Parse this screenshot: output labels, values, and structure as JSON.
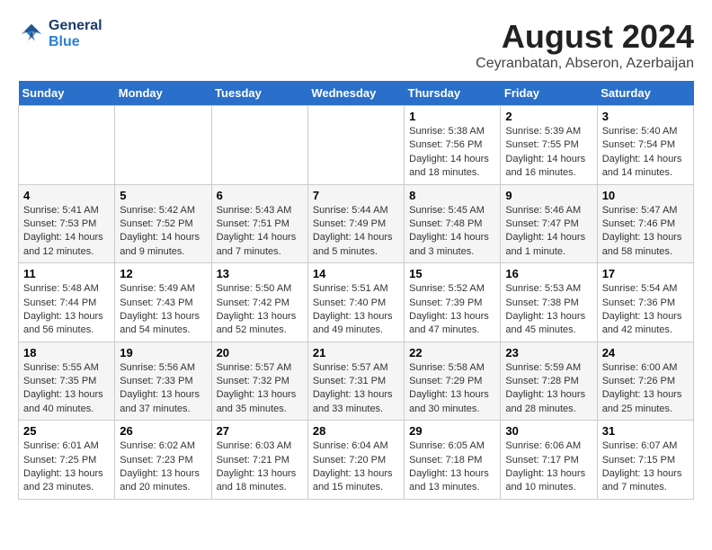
{
  "header": {
    "logo_line1": "General",
    "logo_line2": "Blue",
    "title": "August 2024",
    "subtitle": "Ceyranbatan, Abseron, Azerbaijan"
  },
  "weekdays": [
    "Sunday",
    "Monday",
    "Tuesday",
    "Wednesday",
    "Thursday",
    "Friday",
    "Saturday"
  ],
  "weeks": [
    [
      {
        "day": "",
        "info": ""
      },
      {
        "day": "",
        "info": ""
      },
      {
        "day": "",
        "info": ""
      },
      {
        "day": "",
        "info": ""
      },
      {
        "day": "1",
        "sunrise": "Sunrise: 5:38 AM",
        "sunset": "Sunset: 7:56 PM",
        "daylight": "Daylight: 14 hours and 18 minutes."
      },
      {
        "day": "2",
        "sunrise": "Sunrise: 5:39 AM",
        "sunset": "Sunset: 7:55 PM",
        "daylight": "Daylight: 14 hours and 16 minutes."
      },
      {
        "day": "3",
        "sunrise": "Sunrise: 5:40 AM",
        "sunset": "Sunset: 7:54 PM",
        "daylight": "Daylight: 14 hours and 14 minutes."
      }
    ],
    [
      {
        "day": "4",
        "sunrise": "Sunrise: 5:41 AM",
        "sunset": "Sunset: 7:53 PM",
        "daylight": "Daylight: 14 hours and 12 minutes."
      },
      {
        "day": "5",
        "sunrise": "Sunrise: 5:42 AM",
        "sunset": "Sunset: 7:52 PM",
        "daylight": "Daylight: 14 hours and 9 minutes."
      },
      {
        "day": "6",
        "sunrise": "Sunrise: 5:43 AM",
        "sunset": "Sunset: 7:51 PM",
        "daylight": "Daylight: 14 hours and 7 minutes."
      },
      {
        "day": "7",
        "sunrise": "Sunrise: 5:44 AM",
        "sunset": "Sunset: 7:49 PM",
        "daylight": "Daylight: 14 hours and 5 minutes."
      },
      {
        "day": "8",
        "sunrise": "Sunrise: 5:45 AM",
        "sunset": "Sunset: 7:48 PM",
        "daylight": "Daylight: 14 hours and 3 minutes."
      },
      {
        "day": "9",
        "sunrise": "Sunrise: 5:46 AM",
        "sunset": "Sunset: 7:47 PM",
        "daylight": "Daylight: 14 hours and 1 minute."
      },
      {
        "day": "10",
        "sunrise": "Sunrise: 5:47 AM",
        "sunset": "Sunset: 7:46 PM",
        "daylight": "Daylight: 13 hours and 58 minutes."
      }
    ],
    [
      {
        "day": "11",
        "sunrise": "Sunrise: 5:48 AM",
        "sunset": "Sunset: 7:44 PM",
        "daylight": "Daylight: 13 hours and 56 minutes."
      },
      {
        "day": "12",
        "sunrise": "Sunrise: 5:49 AM",
        "sunset": "Sunset: 7:43 PM",
        "daylight": "Daylight: 13 hours and 54 minutes."
      },
      {
        "day": "13",
        "sunrise": "Sunrise: 5:50 AM",
        "sunset": "Sunset: 7:42 PM",
        "daylight": "Daylight: 13 hours and 52 minutes."
      },
      {
        "day": "14",
        "sunrise": "Sunrise: 5:51 AM",
        "sunset": "Sunset: 7:40 PM",
        "daylight": "Daylight: 13 hours and 49 minutes."
      },
      {
        "day": "15",
        "sunrise": "Sunrise: 5:52 AM",
        "sunset": "Sunset: 7:39 PM",
        "daylight": "Daylight: 13 hours and 47 minutes."
      },
      {
        "day": "16",
        "sunrise": "Sunrise: 5:53 AM",
        "sunset": "Sunset: 7:38 PM",
        "daylight": "Daylight: 13 hours and 45 minutes."
      },
      {
        "day": "17",
        "sunrise": "Sunrise: 5:54 AM",
        "sunset": "Sunset: 7:36 PM",
        "daylight": "Daylight: 13 hours and 42 minutes."
      }
    ],
    [
      {
        "day": "18",
        "sunrise": "Sunrise: 5:55 AM",
        "sunset": "Sunset: 7:35 PM",
        "daylight": "Daylight: 13 hours and 40 minutes."
      },
      {
        "day": "19",
        "sunrise": "Sunrise: 5:56 AM",
        "sunset": "Sunset: 7:33 PM",
        "daylight": "Daylight: 13 hours and 37 minutes."
      },
      {
        "day": "20",
        "sunrise": "Sunrise: 5:57 AM",
        "sunset": "Sunset: 7:32 PM",
        "daylight": "Daylight: 13 hours and 35 minutes."
      },
      {
        "day": "21",
        "sunrise": "Sunrise: 5:57 AM",
        "sunset": "Sunset: 7:31 PM",
        "daylight": "Daylight: 13 hours and 33 minutes."
      },
      {
        "day": "22",
        "sunrise": "Sunrise: 5:58 AM",
        "sunset": "Sunset: 7:29 PM",
        "daylight": "Daylight: 13 hours and 30 minutes."
      },
      {
        "day": "23",
        "sunrise": "Sunrise: 5:59 AM",
        "sunset": "Sunset: 7:28 PM",
        "daylight": "Daylight: 13 hours and 28 minutes."
      },
      {
        "day": "24",
        "sunrise": "Sunrise: 6:00 AM",
        "sunset": "Sunset: 7:26 PM",
        "daylight": "Daylight: 13 hours and 25 minutes."
      }
    ],
    [
      {
        "day": "25",
        "sunrise": "Sunrise: 6:01 AM",
        "sunset": "Sunset: 7:25 PM",
        "daylight": "Daylight: 13 hours and 23 minutes."
      },
      {
        "day": "26",
        "sunrise": "Sunrise: 6:02 AM",
        "sunset": "Sunset: 7:23 PM",
        "daylight": "Daylight: 13 hours and 20 minutes."
      },
      {
        "day": "27",
        "sunrise": "Sunrise: 6:03 AM",
        "sunset": "Sunset: 7:21 PM",
        "daylight": "Daylight: 13 hours and 18 minutes."
      },
      {
        "day": "28",
        "sunrise": "Sunrise: 6:04 AM",
        "sunset": "Sunset: 7:20 PM",
        "daylight": "Daylight: 13 hours and 15 minutes."
      },
      {
        "day": "29",
        "sunrise": "Sunrise: 6:05 AM",
        "sunset": "Sunset: 7:18 PM",
        "daylight": "Daylight: 13 hours and 13 minutes."
      },
      {
        "day": "30",
        "sunrise": "Sunrise: 6:06 AM",
        "sunset": "Sunset: 7:17 PM",
        "daylight": "Daylight: 13 hours and 10 minutes."
      },
      {
        "day": "31",
        "sunrise": "Sunrise: 6:07 AM",
        "sunset": "Sunset: 7:15 PM",
        "daylight": "Daylight: 13 hours and 7 minutes."
      }
    ]
  ]
}
